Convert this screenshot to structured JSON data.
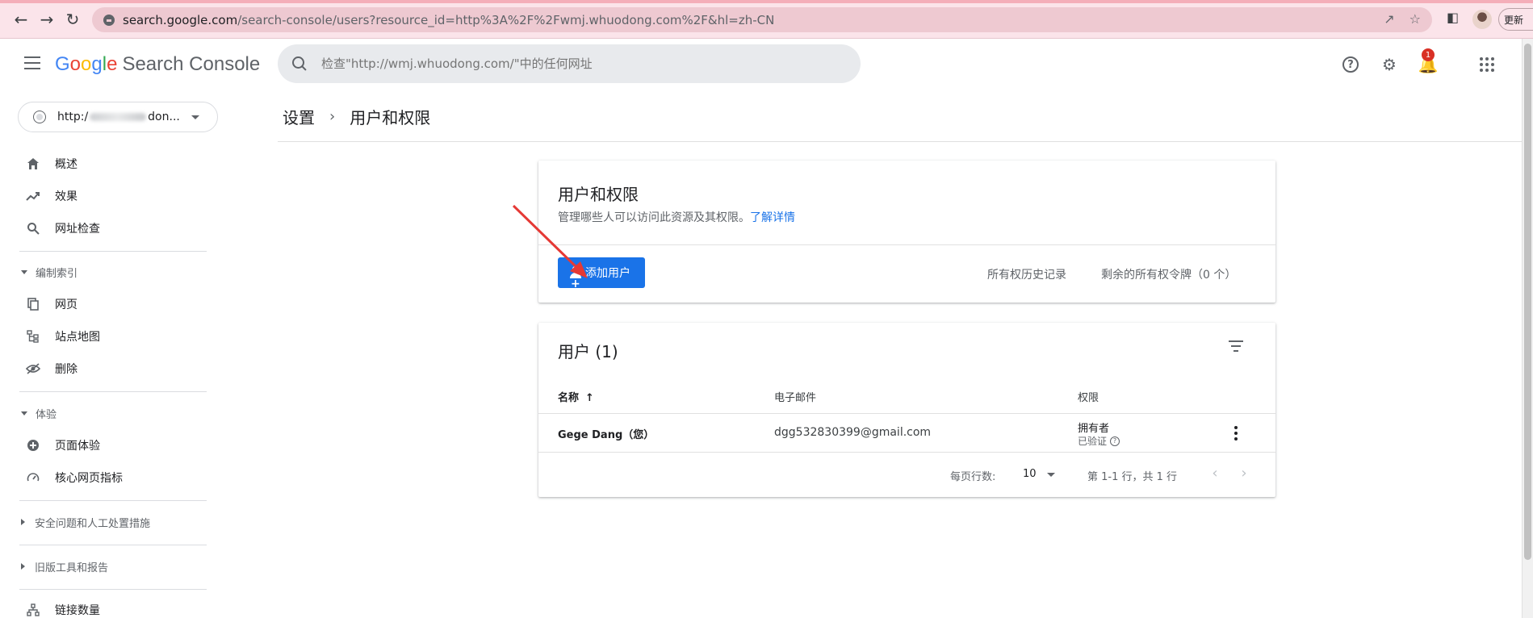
{
  "browser": {
    "url_domain": "search.google.com",
    "url_rest": "/search-console/users?resource_id=http%3A%2F%2Fwmj.whuodong.com%2F&hl=zh-CN",
    "more_label": "更新"
  },
  "header": {
    "logo_letters": [
      "G",
      "o",
      "o",
      "g",
      "l",
      "e"
    ],
    "product": "Search Console",
    "search_placeholder": "检查\"http://wmj.whuodong.com/\"中的任何网址",
    "notification_count": "1"
  },
  "sidebar": {
    "property": {
      "prefix": "http:/",
      "suffix": "don..."
    },
    "items": [
      {
        "label": "概述",
        "icon": "home-icon"
      },
      {
        "label": "效果",
        "icon": "trending-up-icon"
      },
      {
        "label": "网址检查",
        "icon": "search-icon"
      }
    ],
    "index_section": "编制索引",
    "index_items": [
      {
        "label": "网页",
        "icon": "pages-icon"
      },
      {
        "label": "站点地图",
        "icon": "sitemap-icon"
      },
      {
        "label": "删除",
        "icon": "visibility-off-icon"
      }
    ],
    "experience_section": "体验",
    "experience_items": [
      {
        "label": "页面体验",
        "icon": "add-circle-icon"
      },
      {
        "label": "核心网页指标",
        "icon": "speed-icon"
      }
    ],
    "security_section": "安全问题和人工处置措施",
    "legacy_section": "旧版工具和报告",
    "links_item": {
      "label": "链接数量",
      "icon": "links-icon"
    }
  },
  "breadcrumb": {
    "parent": "设置",
    "current": "用户和权限"
  },
  "permissions_card": {
    "title": "用户和权限",
    "description": "管理哪些人可以访问此资源及其权限。",
    "learn_more": "了解详情",
    "add_user": "添加用户",
    "ownership_history": "所有权历史记录",
    "remaining_tokens": "剩余的所有权令牌（0 个）"
  },
  "users_card": {
    "title": "用户 (1)",
    "columns": {
      "name": "名称",
      "email": "电子邮件",
      "permission": "权限"
    },
    "rows": [
      {
        "name": "Gege Dang（您）",
        "email": "dgg532830399@gmail.com",
        "permission": "拥有者",
        "status": "已验证"
      }
    ],
    "rows_per_page_label": "每页行数:",
    "rows_per_page": "10",
    "range": "第 1-1 行，共 1 行"
  },
  "colors": {
    "accent": "#1a73e8",
    "annotation": "#e53935",
    "browser_bar": "#fbe4ea"
  }
}
